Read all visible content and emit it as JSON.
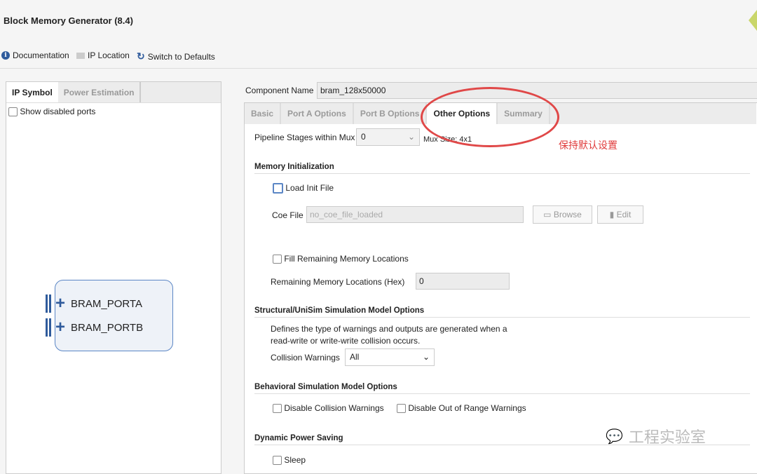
{
  "window": {
    "title": "Block Memory Generator (8.4)"
  },
  "toolbar": {
    "documentation": "Documentation",
    "ip_location": "IP Location",
    "switch_defaults": "Switch to Defaults"
  },
  "left": {
    "tabs": [
      "IP Symbol",
      "Power Estimation"
    ],
    "show_disabled": "Show disabled ports",
    "ports": [
      "BRAM_PORTA",
      "BRAM_PORTB"
    ]
  },
  "component": {
    "label": "Component Name",
    "value": "bram_128x50000"
  },
  "tabs": [
    "Basic",
    "Port A Options",
    "Port B Options",
    "Other Options",
    "Summary"
  ],
  "other": {
    "pipeline_label": "Pipeline Stages within Mux",
    "pipeline_value": "0",
    "mux_size": "Mux Size: 4x1",
    "mem_init": "Memory Initialization",
    "load_init": "Load Init File",
    "coe_label": "Coe File",
    "coe_value": "no_coe_file_loaded",
    "browse": "Browse",
    "edit": "Edit",
    "fill_remaining": "Fill Remaining Memory Locations",
    "remaining_label": "Remaining Memory Locations (Hex)",
    "remaining_value": "0",
    "structural": "Structural/UniSim Simulation Model Options",
    "desc1": "Defines the type of warnings and outputs are generated when a",
    "desc2": "read-write or write-write collision occurs.",
    "collision_label": "Collision Warnings",
    "collision_value": "All",
    "behavioral": "Behavioral Simulation Model Options",
    "disable_collision": "Disable Collision Warnings",
    "disable_range": "Disable Out of Range Warnings",
    "power": "Dynamic Power Saving",
    "sleep": "Sleep"
  },
  "annotation": {
    "note": "保持默认设置",
    "color": "#e03c3c"
  },
  "watermark": "工程实验室"
}
